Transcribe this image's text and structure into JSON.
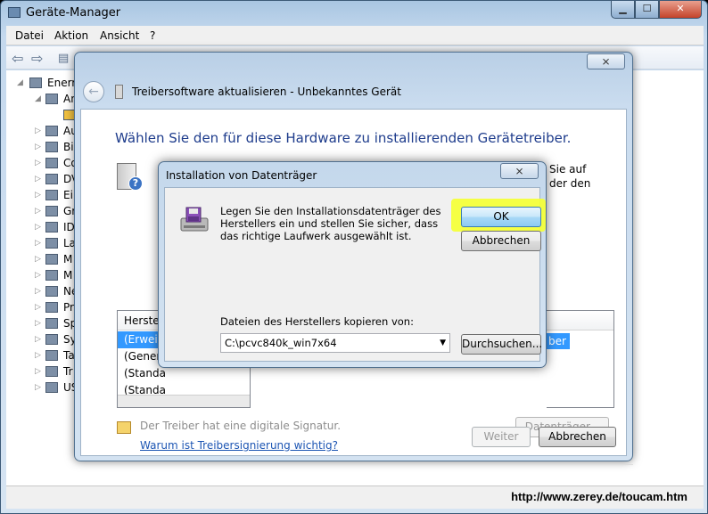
{
  "device_manager": {
    "title": "Geräte-Manager",
    "menu": [
      "Datei",
      "Aktion",
      "Ansicht",
      "?"
    ],
    "tree": [
      {
        "label": "Enerr"
      },
      {
        "label": "An"
      },
      {
        "label": ""
      },
      {
        "label": "Au"
      },
      {
        "label": "Bi"
      },
      {
        "label": "Co"
      },
      {
        "label": "DV"
      },
      {
        "label": "Ei"
      },
      {
        "label": "Gr"
      },
      {
        "label": "ID"
      },
      {
        "label": "La"
      },
      {
        "label": "M"
      },
      {
        "label": "M"
      },
      {
        "label": "Ne"
      },
      {
        "label": "Pr"
      },
      {
        "label": "Sp"
      },
      {
        "label": "Sy"
      },
      {
        "label": "Ta"
      },
      {
        "label": "Tr"
      },
      {
        "label": "US"
      }
    ],
    "status_url": "http://www.zerey.de/toucam.htm"
  },
  "wizard": {
    "title": "Treibersoftware aktualisieren - Unbekanntes Gerät",
    "close_label": "⨯",
    "heading": "Wählen Sie den für diese Hardware zu installierenden Gerätetreiber.",
    "side_text_1": "Sie auf",
    "side_text_2": "der den",
    "manufacturer_header": "Herstell",
    "manufacturers": [
      "(Erweite",
      "(Generic",
      "(Standa",
      "(Standa"
    ],
    "model_selected": "ber",
    "signature_text": "Der Treiber hat eine digitale Signatur.",
    "signature_link": "Warum ist Treibersignierung wichtig?",
    "have_disk_label": "Datenträger...",
    "next_label": "Weiter",
    "cancel_label": "Abbrechen"
  },
  "disk_dialog": {
    "title": "Installation von Datenträger",
    "close_label": "⨯",
    "message": "Legen Sie den Installationsdatenträger des Herstellers ein und stellen Sie sicher, dass das richtige Laufwerk ausgewählt ist.",
    "ok_label": "OK",
    "cancel_label": "Abbrechen",
    "copy_label": "Dateien des Herstellers kopieren von:",
    "path_value": "C:\\pcvc840k_win7x64",
    "browse_label": "Durchsuchen...",
    "highlight_color": "#f4ff3a"
  }
}
